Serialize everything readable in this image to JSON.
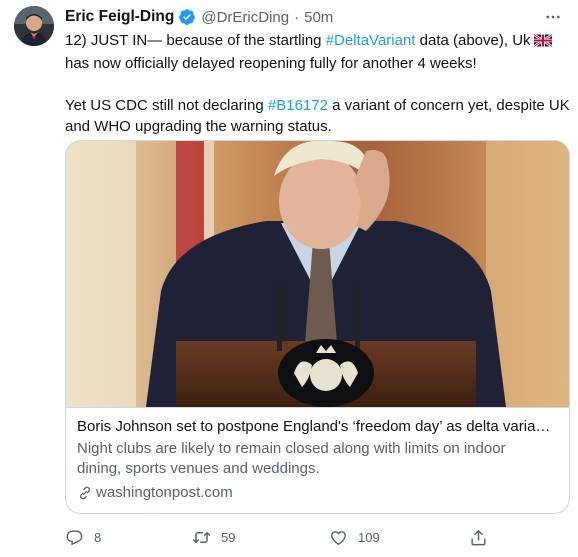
{
  "author": {
    "name": "Eric Feigl-Ding",
    "handle": "@DrEricDing",
    "time": "50m"
  },
  "tweet": {
    "line1_prefix": "12) JUST IN— because of the startling ",
    "line1_hashtag": "#DeltaVariant",
    "line1_suffix": " data (above), Uk",
    "line2": "has now officially delayed reopening fully for another 4 weeks!",
    "line3_prefix": "Yet US CDC still not declaring ",
    "line3_hashtag": "#B16172",
    "line3_suffix": " a variant of concern yet, despite UK",
    "line4": "and WHO upgrading the warning status."
  },
  "card": {
    "title": "Boris Johnson set to postpone England's ‘freedom day’ as delta variant...",
    "description_line1": "Night clubs are likely to remain closed along with limits on indoor",
    "description_line2": "dining, sports venues and weddings.",
    "domain": "washingtonpost.com"
  },
  "actions": {
    "reply_count": "8",
    "retweet_count": "59",
    "like_count": "109"
  },
  "colors": {
    "link": "#1d9bf0",
    "secondary_text": "#536471",
    "border": "#cfd9de",
    "verified": "#1d9bf0"
  },
  "icons": {
    "verified": "verified-badge-icon",
    "more": "more-horizontal-icon",
    "reply": "reply-icon",
    "retweet": "retweet-icon",
    "like": "heart-icon",
    "share": "share-icon",
    "link": "link-icon",
    "flag": "uk-flag-icon"
  }
}
